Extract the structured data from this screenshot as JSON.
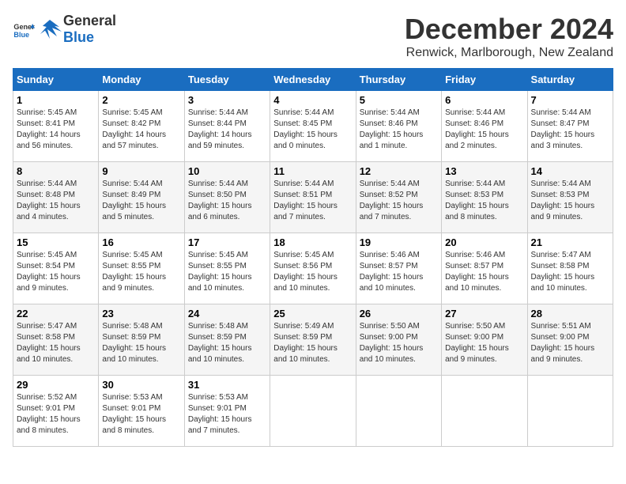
{
  "header": {
    "logo_general": "General",
    "logo_blue": "Blue",
    "month_title": "December 2024",
    "location": "Renwick, Marlborough, New Zealand"
  },
  "days_of_week": [
    "Sunday",
    "Monday",
    "Tuesday",
    "Wednesday",
    "Thursday",
    "Friday",
    "Saturday"
  ],
  "weeks": [
    [
      {
        "day": "1",
        "sunrise": "5:45 AM",
        "sunset": "8:41 PM",
        "daylight": "14 hours and 56 minutes."
      },
      {
        "day": "2",
        "sunrise": "5:45 AM",
        "sunset": "8:42 PM",
        "daylight": "14 hours and 57 minutes."
      },
      {
        "day": "3",
        "sunrise": "5:44 AM",
        "sunset": "8:44 PM",
        "daylight": "14 hours and 59 minutes."
      },
      {
        "day": "4",
        "sunrise": "5:44 AM",
        "sunset": "8:45 PM",
        "daylight": "15 hours and 0 minutes."
      },
      {
        "day": "5",
        "sunrise": "5:44 AM",
        "sunset": "8:46 PM",
        "daylight": "15 hours and 1 minute."
      },
      {
        "day": "6",
        "sunrise": "5:44 AM",
        "sunset": "8:46 PM",
        "daylight": "15 hours and 2 minutes."
      },
      {
        "day": "7",
        "sunrise": "5:44 AM",
        "sunset": "8:47 PM",
        "daylight": "15 hours and 3 minutes."
      }
    ],
    [
      {
        "day": "8",
        "sunrise": "5:44 AM",
        "sunset": "8:48 PM",
        "daylight": "15 hours and 4 minutes."
      },
      {
        "day": "9",
        "sunrise": "5:44 AM",
        "sunset": "8:49 PM",
        "daylight": "15 hours and 5 minutes."
      },
      {
        "day": "10",
        "sunrise": "5:44 AM",
        "sunset": "8:50 PM",
        "daylight": "15 hours and 6 minutes."
      },
      {
        "day": "11",
        "sunrise": "5:44 AM",
        "sunset": "8:51 PM",
        "daylight": "15 hours and 7 minutes."
      },
      {
        "day": "12",
        "sunrise": "5:44 AM",
        "sunset": "8:52 PM",
        "daylight": "15 hours and 7 minutes."
      },
      {
        "day": "13",
        "sunrise": "5:44 AM",
        "sunset": "8:53 PM",
        "daylight": "15 hours and 8 minutes."
      },
      {
        "day": "14",
        "sunrise": "5:44 AM",
        "sunset": "8:53 PM",
        "daylight": "15 hours and 9 minutes."
      }
    ],
    [
      {
        "day": "15",
        "sunrise": "5:45 AM",
        "sunset": "8:54 PM",
        "daylight": "15 hours and 9 minutes."
      },
      {
        "day": "16",
        "sunrise": "5:45 AM",
        "sunset": "8:55 PM",
        "daylight": "15 hours and 9 minutes."
      },
      {
        "day": "17",
        "sunrise": "5:45 AM",
        "sunset": "8:55 PM",
        "daylight": "15 hours and 10 minutes."
      },
      {
        "day": "18",
        "sunrise": "5:45 AM",
        "sunset": "8:56 PM",
        "daylight": "15 hours and 10 minutes."
      },
      {
        "day": "19",
        "sunrise": "5:46 AM",
        "sunset": "8:57 PM",
        "daylight": "15 hours and 10 minutes."
      },
      {
        "day": "20",
        "sunrise": "5:46 AM",
        "sunset": "8:57 PM",
        "daylight": "15 hours and 10 minutes."
      },
      {
        "day": "21",
        "sunrise": "5:47 AM",
        "sunset": "8:58 PM",
        "daylight": "15 hours and 10 minutes."
      }
    ],
    [
      {
        "day": "22",
        "sunrise": "5:47 AM",
        "sunset": "8:58 PM",
        "daylight": "15 hours and 10 minutes."
      },
      {
        "day": "23",
        "sunrise": "5:48 AM",
        "sunset": "8:59 PM",
        "daylight": "15 hours and 10 minutes."
      },
      {
        "day": "24",
        "sunrise": "5:48 AM",
        "sunset": "8:59 PM",
        "daylight": "15 hours and 10 minutes."
      },
      {
        "day": "25",
        "sunrise": "5:49 AM",
        "sunset": "8:59 PM",
        "daylight": "15 hours and 10 minutes."
      },
      {
        "day": "26",
        "sunrise": "5:50 AM",
        "sunset": "9:00 PM",
        "daylight": "15 hours and 10 minutes."
      },
      {
        "day": "27",
        "sunrise": "5:50 AM",
        "sunset": "9:00 PM",
        "daylight": "15 hours and 9 minutes."
      },
      {
        "day": "28",
        "sunrise": "5:51 AM",
        "sunset": "9:00 PM",
        "daylight": "15 hours and 9 minutes."
      }
    ],
    [
      {
        "day": "29",
        "sunrise": "5:52 AM",
        "sunset": "9:01 PM",
        "daylight": "15 hours and 8 minutes."
      },
      {
        "day": "30",
        "sunrise": "5:53 AM",
        "sunset": "9:01 PM",
        "daylight": "15 hours and 8 minutes."
      },
      {
        "day": "31",
        "sunrise": "5:53 AM",
        "sunset": "9:01 PM",
        "daylight": "15 hours and 7 minutes."
      },
      null,
      null,
      null,
      null
    ]
  ]
}
